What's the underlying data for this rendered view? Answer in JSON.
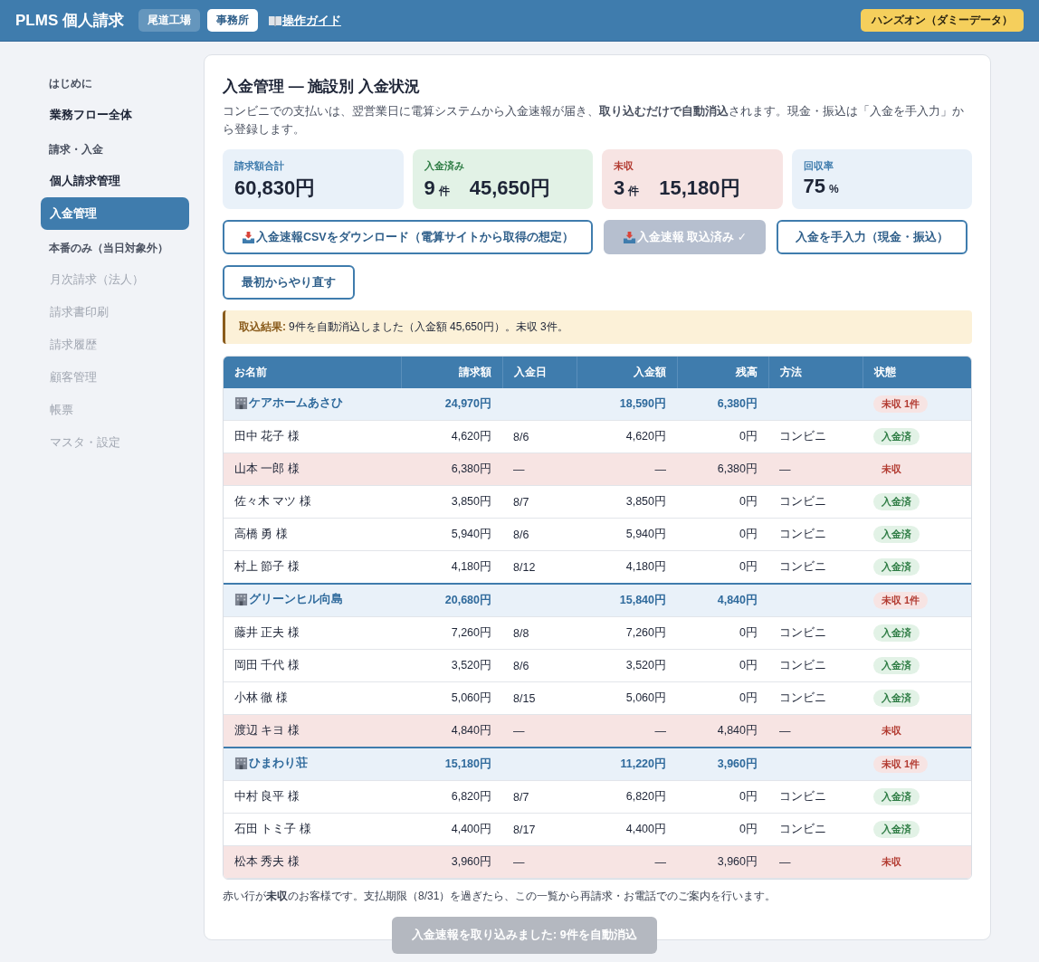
{
  "header": {
    "brand": "PLMS 個人請求",
    "tabs": [
      {
        "label": "尾道工場",
        "selected": false
      },
      {
        "label": "事務所",
        "selected": true
      }
    ],
    "guide_link": "操作ガイド",
    "badge": "ハンズオン（ダミーデータ）"
  },
  "sidebar": {
    "sections": [
      {
        "heading": "はじめに",
        "items": [
          {
            "label": "業務フロー全体",
            "selected": false,
            "disabled": false
          }
        ]
      },
      {
        "heading": "請求・入金",
        "items": [
          {
            "label": "個人請求管理",
            "selected": false,
            "disabled": false
          },
          {
            "label": "入金管理",
            "selected": true,
            "disabled": false
          }
        ]
      },
      {
        "heading": "本番のみ（当日対象外）",
        "items": [
          {
            "label": "月次請求（法人）",
            "selected": false,
            "disabled": true
          },
          {
            "label": "請求書印刷",
            "selected": false,
            "disabled": true
          },
          {
            "label": "請求履歴",
            "selected": false,
            "disabled": true
          },
          {
            "label": "顧客管理",
            "selected": false,
            "disabled": true
          },
          {
            "label": "帳票",
            "selected": false,
            "disabled": true
          },
          {
            "label": "マスタ・設定",
            "selected": false,
            "disabled": true
          }
        ]
      }
    ]
  },
  "main": {
    "title": "入金管理 — 施設別 入金状況",
    "description": "コンビニでの支払いは、翌営業日に電算システムから入金速報が届き、**取り込むだけで自動消込**されます。現金・振込は「入金を手入力」から登録します。",
    "stats": [
      {
        "kind": "total",
        "label": "請求額合計",
        "parts": [
          {
            "value": "60,830円"
          }
        ]
      },
      {
        "kind": "paid",
        "label": "入金済み",
        "parts": [
          {
            "value": "9",
            "unit": "件"
          },
          {
            "value": "45,650円"
          }
        ]
      },
      {
        "kind": "unpaid",
        "label": "未収",
        "parts": [
          {
            "value": "3",
            "unit": "件"
          },
          {
            "value": "15,180円"
          }
        ]
      },
      {
        "kind": "rate",
        "label": "回収率",
        "parts": [
          {
            "value": "75",
            "unit": "%"
          }
        ]
      }
    ],
    "buttons": [
      {
        "kind": "import",
        "label": "入金速報CSVをダウンロード（電算サイトから取得の想定）",
        "disabled": false
      },
      {
        "kind": "import",
        "label": "入金速報 取込済み ✓",
        "disabled": true
      },
      {
        "kind": "plain",
        "label": "入金を手入力（現金・振込）",
        "disabled": false
      },
      {
        "kind": "plain",
        "label": "最初からやり直す",
        "disabled": false
      }
    ],
    "notice": {
      "label": "取込結果:",
      "text": "9件を自動消込しました（入金額 45,650円）。未収 3件。"
    },
    "table": {
      "columns": [
        "お名前",
        "請求額",
        "入金日",
        "入金額",
        "残高",
        "方法",
        "状態"
      ],
      "groups": [
        {
          "name": "ケアホームあさひ",
          "billed": "24,970円",
          "paid": "18,590円",
          "balance": "6,380円",
          "status": "未収 1件",
          "rows": [
            {
              "name": "田中 花子 様",
              "billed": "4,620円",
              "date": "8/6",
              "paid": "4,620円",
              "balance": "0円",
              "method": "コンビニ",
              "status": "入金済",
              "unpaid": false
            },
            {
              "name": "山本 一郎 様",
              "billed": "6,380円",
              "date": "—",
              "paid": "—",
              "balance": "6,380円",
              "method": "—",
              "status": "未収",
              "unpaid": true
            },
            {
              "name": "佐々木 マツ 様",
              "billed": "3,850円",
              "date": "8/7",
              "paid": "3,850円",
              "balance": "0円",
              "method": "コンビニ",
              "status": "入金済",
              "unpaid": false
            },
            {
              "name": "高橋 勇 様",
              "billed": "5,940円",
              "date": "8/6",
              "paid": "5,940円",
              "balance": "0円",
              "method": "コンビニ",
              "status": "入金済",
              "unpaid": false
            },
            {
              "name": "村上 節子 様",
              "billed": "4,180円",
              "date": "8/12",
              "paid": "4,180円",
              "balance": "0円",
              "method": "コンビニ",
              "status": "入金済",
              "unpaid": false
            }
          ]
        },
        {
          "name": "グリーンヒル向島",
          "billed": "20,680円",
          "paid": "15,840円",
          "balance": "4,840円",
          "status": "未収 1件",
          "rows": [
            {
              "name": "藤井 正夫 様",
              "billed": "7,260円",
              "date": "8/8",
              "paid": "7,260円",
              "balance": "0円",
              "method": "コンビニ",
              "status": "入金済",
              "unpaid": false
            },
            {
              "name": "岡田 千代 様",
              "billed": "3,520円",
              "date": "8/6",
              "paid": "3,520円",
              "balance": "0円",
              "method": "コンビニ",
              "status": "入金済",
              "unpaid": false
            },
            {
              "name": "小林 徹 様",
              "billed": "5,060円",
              "date": "8/15",
              "paid": "5,060円",
              "balance": "0円",
              "method": "コンビニ",
              "status": "入金済",
              "unpaid": false
            },
            {
              "name": "渡辺 キヨ 様",
              "billed": "4,840円",
              "date": "—",
              "paid": "—",
              "balance": "4,840円",
              "method": "—",
              "status": "未収",
              "unpaid": true
            }
          ]
        },
        {
          "name": "ひまわり荘",
          "billed": "15,180円",
          "paid": "11,220円",
          "balance": "3,960円",
          "status": "未収 1件",
          "rows": [
            {
              "name": "中村 良平 様",
              "billed": "6,820円",
              "date": "8/7",
              "paid": "6,820円",
              "balance": "0円",
              "method": "コンビニ",
              "status": "入金済",
              "unpaid": false
            },
            {
              "name": "石田 トミ子 様",
              "billed": "4,400円",
              "date": "8/17",
              "paid": "4,400円",
              "balance": "0円",
              "method": "コンビニ",
              "status": "入金済",
              "unpaid": false
            },
            {
              "name": "松本 秀夫 様",
              "billed": "3,960円",
              "date": "—",
              "paid": "—",
              "balance": "3,960円",
              "method": "—",
              "status": "未収",
              "unpaid": true
            }
          ]
        }
      ]
    },
    "footnote": "赤い行が**未収**のお客様です。支払期限（8/31）を過ぎたら、この一覧から再請求・お電話でのご案内を行います。",
    "toast": "入金速報を取り込みました: 9件を自動消込"
  }
}
